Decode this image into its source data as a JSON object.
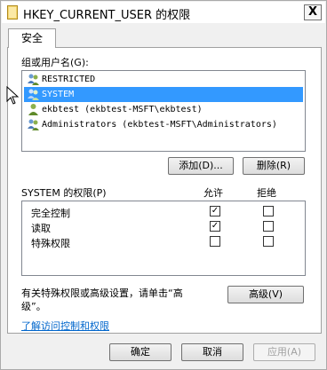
{
  "window": {
    "title": "HKEY_CURRENT_USER 的权限",
    "close_label": "X"
  },
  "tabs": [
    {
      "label": "安全",
      "active": true
    }
  ],
  "groups": {
    "label": "组或用户名(G):",
    "items": [
      {
        "label": "RESTRICTED",
        "selected": false,
        "icon": "users-group-icon"
      },
      {
        "label": "SYSTEM",
        "selected": true,
        "icon": "users-group-icon"
      },
      {
        "label": "ekbtest (ekbtest-MSFT\\ekbtest)",
        "selected": false,
        "icon": "user-icon"
      },
      {
        "label": "Administrators (ekbtest-MSFT\\Administrators)",
        "selected": false,
        "icon": "users-group-icon"
      }
    ],
    "add_label": "添加(D)...",
    "remove_label": "删除(R)"
  },
  "permissions": {
    "title": "SYSTEM 的权限(P)",
    "allow_header": "允许",
    "deny_header": "拒绝",
    "rows": [
      {
        "label": "完全控制",
        "allow": true,
        "deny": false
      },
      {
        "label": "读取",
        "allow": true,
        "deny": false
      },
      {
        "label": "特殊权限",
        "allow": false,
        "deny": false
      }
    ]
  },
  "advanced": {
    "text_line1": "有关特殊权限或高级设置，请单击“高",
    "text_line2": "级”。",
    "button_label": "高级(V)"
  },
  "help_link": "了解访问控制和权限",
  "footer": {
    "ok_label": "确定",
    "cancel_label": "取消",
    "apply_label": "应用(A)"
  },
  "colors": {
    "selection": "#3399ff",
    "link": "#0066cc"
  }
}
